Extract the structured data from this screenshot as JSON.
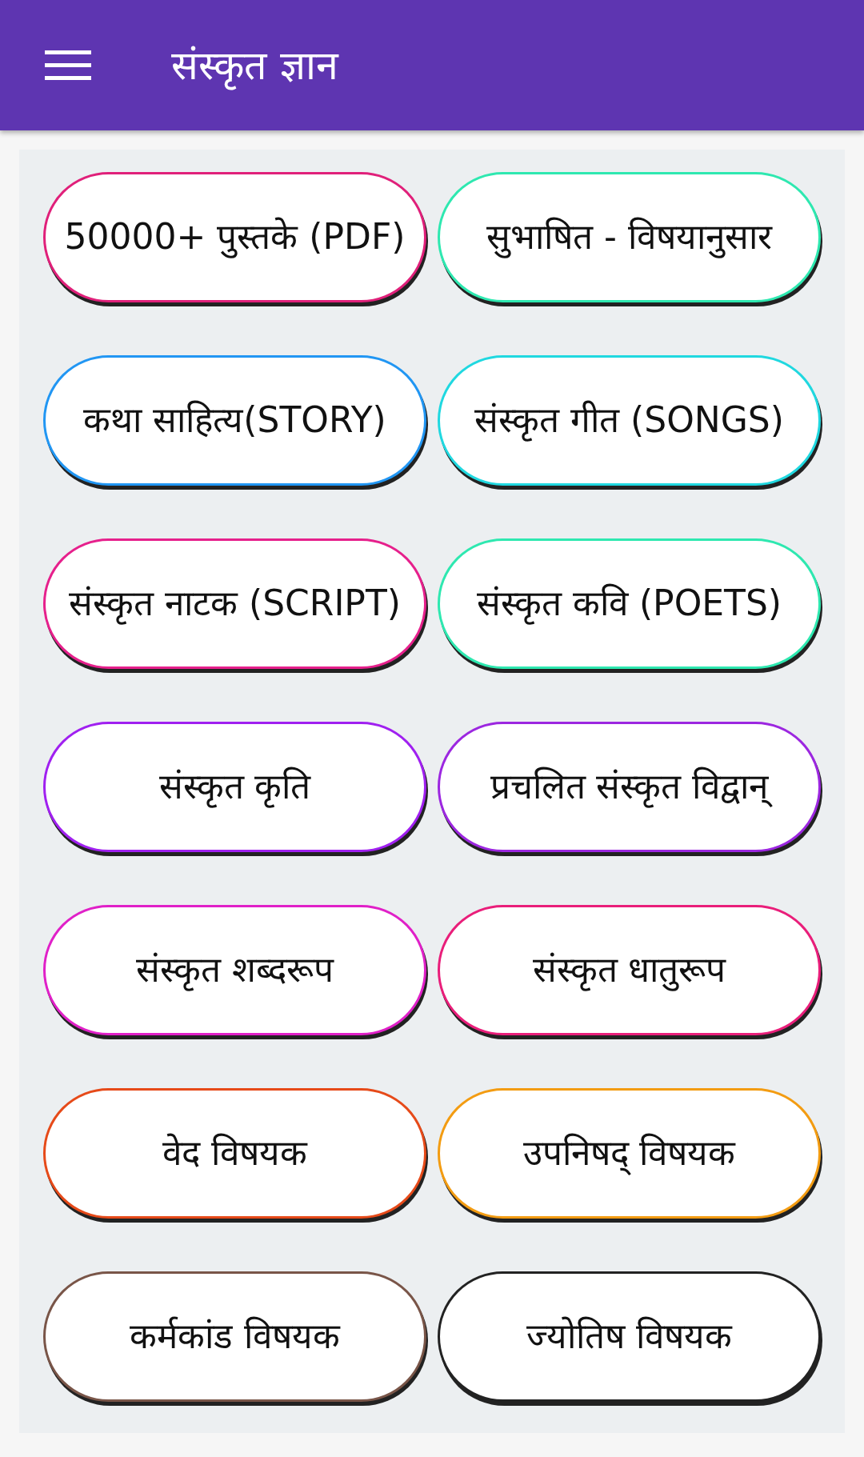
{
  "app_bar": {
    "title": "संस्कृत ज्ञान"
  },
  "buttons": [
    {
      "label": "50000+ पुस्तके (PDF)",
      "color": "#e0207a"
    },
    {
      "label": "सुभाषित - विषयानुसार",
      "color": "#2ee8b0"
    },
    {
      "label": "कथा साहित्य(STORY)",
      "color": "#2196f3"
    },
    {
      "label": "संस्कृत गीत (SONGS)",
      "color": "#20d8e0"
    },
    {
      "label": "संस्कृत नाटक (SCRIPT)",
      "color": "#e6208c"
    },
    {
      "label": "संस्कृत कवि (POETS)",
      "color": "#2ee8b0"
    },
    {
      "label": "संस्कृत कृति",
      "color": "#a020f0"
    },
    {
      "label": "प्रचलित संस्कृत विद्वान्",
      "color": "#9c27e0"
    },
    {
      "label": "संस्कृत शब्दरूप",
      "color": "#e020c8"
    },
    {
      "label": "संस्कृत धातुरूप",
      "color": "#e91e7a"
    },
    {
      "label": "वेद विषयक",
      "color": "#e64a19"
    },
    {
      "label": "उपनिषद् विषयक",
      "color": "#f39c12"
    },
    {
      "label": "कर्मकांड विषयक",
      "color": "#795548"
    },
    {
      "label": "ज्योतिष विषयक",
      "color": "#222222"
    }
  ]
}
